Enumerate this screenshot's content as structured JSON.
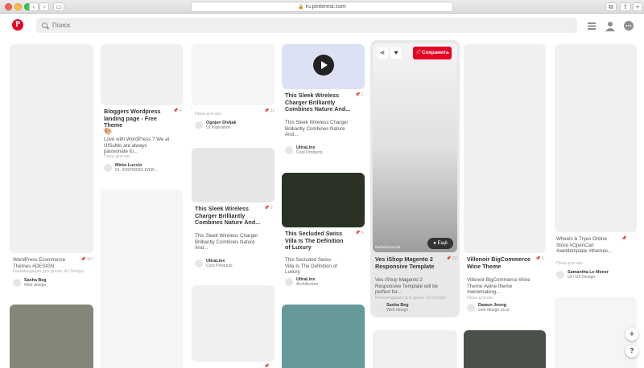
{
  "browser": {
    "url": "ru.pinterest.com"
  },
  "header": {
    "search_placeholder": "Поиск"
  },
  "pins": [
    {
      "title": "",
      "desc": "WordPress Ecommerce Themes #DESIGN",
      "recommend": "Рекомендация для доски -AJ Design-",
      "pin_count": "117",
      "user": "Sasha Beg",
      "category": "Web design"
    },
    {
      "title": "Bloggers Wordpress landing page - Free Theme",
      "desc": "Love with WordPress ? We at UISuMo are always passionate to...",
      "recommend": "Пины для вас",
      "pin_count": "4",
      "user": "Mirko Luccio",
      "category": "01. INSPIRING WEB..."
    },
    {
      "title": "",
      "desc": "",
      "recommend": "Пины для вас",
      "pin_count": "11",
      "user": "Ognjen Divljak",
      "category": "UI Inspiration"
    },
    {
      "title": "This Sleek Wireless Charger Brilliantly Combines Nature And...",
      "desc": "This Sleek Wireless Charger Brilliantly Combines Nature And...",
      "recommend": "",
      "pin_count": "1",
      "user": "UltraLinx",
      "category": "Cool Products"
    },
    {
      "title": "This Sleek Wireless Charger Brilliantly Combines Nature And...",
      "desc": "This Sleek Wireless Charger Brilliantly Combines Nature And...",
      "recommend": "",
      "pin_count": "2",
      "user": "UltraLinx",
      "category": "Cool Products"
    },
    {
      "title": "This Secluded Swiss Villa Is The Definition of Luxury",
      "desc": "This Secluded Swiss Villa Is The Definition of Luxury",
      "recommend": "",
      "pin_count": "6",
      "user": "UltraLinx",
      "category": "Architecture"
    },
    {
      "title": "Ves iShop Magento 2 Responsive Template",
      "desc": "Ves iShop Magento 2 Responsive Template will be perfect for...",
      "recommend": "Рекомендация для доски -AJ Design-",
      "pin_count": "22",
      "user": "Sasha Beg",
      "category": "Web design",
      "save_label": "Сохранить",
      "more_label": "Ещё",
      "source": "themeforest.net"
    },
    {
      "title": "Villenoir BigCommerce Wine Theme",
      "desc": "Villenoir BigCommerce Wine Theme #wine theme #winemaking...",
      "recommend": "Пины для вас",
      "pin_count": "6",
      "user": "Dawun Jeong",
      "category": "web design.ux.ui"
    },
    {
      "title": "",
      "desc": "Wheels & Tryes Online Store #OpenCart #webtemplate #themes...",
      "recommend": "Пины для вас",
      "pin_count": "",
      "user": "Samantha Le Mener",
      "category": "UI / UX Design"
    }
  ],
  "colors": {
    "brand": "#e60023",
    "dark_green": "#2a3125",
    "teal": "#65999a",
    "grey_olive": "#85857a",
    "dark_slate": "#4a514b",
    "lavender": "#dde1f4"
  },
  "fab": {
    "plus": "+",
    "help": "?"
  }
}
